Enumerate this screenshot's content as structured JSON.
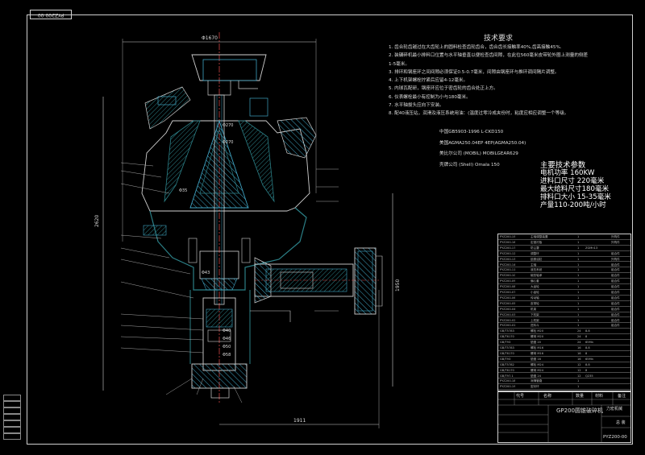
{
  "title_block": {
    "drawing_number": "PYZ200-00",
    "machine_name": "GP200圆锥破碎机",
    "company": "力宏机械",
    "ratio_label": "总 装",
    "code": "PYZ200-00",
    "header_cols": [
      "代号",
      "名称",
      "数量",
      "材料",
      "备注"
    ]
  },
  "technical_requirements": {
    "title": "技术要求",
    "items": [
      "1. 齿合轮齿越过在大齿轮上的圆料检查齿轮齿合，齿合齿长接触率40%,齿高接触45%.",
      "2. 装碾碎机最小排料口位置与水平轴垂直以便检查齿间隙，在此位560毫米皮带轮外圈上测量的侧差",
      "1-5毫米。",
      "3. 排环和钢座环之间间隙必须保证0.5-0.7毫米，间隙由钢座环与推环调间隔片调整。",
      "4. 上下机架螺栓拧紧后应留4-12毫米。",
      "5. 内球瓦配研，钢座环应位于密齿轮的齿合处正上方。",
      "6. 仪表螺栓最小有控制为小与180毫米。",
      "7. 水平轴拔头应向下安装。",
      "8. 配40液压站，润滑及液压系统用油：(温度过零冷成夹份时，粘度应相应调整一个等级。"
    ],
    "standards": [
      "中国GB5903-1996 L-CKD150",
      "美国AGMA250.04EP 4EP(AGMA250.04)",
      "美比尔公司 (MOBIL)      MOBILGEAR629",
      "壳牌公司 (Shell) Omala 150"
    ]
  },
  "main_parameters": {
    "title": "主要技术参数",
    "items": [
      "电机功率 160KW",
      "进料口尺寸 220毫米",
      "最大给料尺寸180毫米",
      "排料口大小 15-35毫米",
      "产量110-200吨/小时"
    ]
  },
  "dimensions": {
    "top_width": "Φ1670",
    "height_total": "2620",
    "right_height": "1950",
    "bottom_width": "1911",
    "d1": "Φ270",
    "d2": "Φ270",
    "d3": "Φ35",
    "d4": "Φ43",
    "d5": "Φ40",
    "d6": "Φ46",
    "d7": "Φ50",
    "d8": "Φ58"
  },
  "parts_list": [
    {
      "code": "PYZ200-15",
      "name": "主轴调整装置",
      "qty": "1",
      "mat": "",
      "note": "外购件"
    },
    {
      "code": "PYZ200-16",
      "name": "定锥衬板",
      "qty": "1",
      "mat": "",
      "note": "外购件"
    },
    {
      "code": "PYZ200-17",
      "name": "防尘罩",
      "qty": "1",
      "mat": "ZGMn13",
      "note": ""
    },
    {
      "code": "PYZ200-12",
      "name": "调整环",
      "qty": "1",
      "mat": "",
      "note": "组合件"
    },
    {
      "code": "PYZ200-13",
      "name": "锁紧油缸",
      "qty": "1",
      "mat": "",
      "note": "外购件"
    },
    {
      "code": "PYZ200-14",
      "name": "主轴",
      "qty": "1",
      "mat": "",
      "note": "组合件"
    },
    {
      "code": "PYZ200-11",
      "name": "液压系统",
      "qty": "1",
      "mat": "",
      "note": "组合件"
    },
    {
      "code": "PYZ200-10",
      "name": "碗形轴承",
      "qty": "1",
      "mat": "",
      "note": "组合件"
    },
    {
      "code": "PYZ200-09",
      "name": "偏心套",
      "qty": "1",
      "mat": "",
      "note": "组合件"
    },
    {
      "code": "PYZ200-08",
      "name": "大齿轮",
      "qty": "1",
      "mat": "",
      "note": "组合件"
    },
    {
      "code": "PYZ200-07",
      "name": "小齿轮",
      "qty": "1",
      "mat": "",
      "note": "组合件"
    },
    {
      "code": "PYZ200-06",
      "name": "传动轴",
      "qty": "1",
      "mat": "",
      "note": "组合件"
    },
    {
      "code": "PYZ200-05",
      "name": "皮带轮",
      "qty": "1",
      "mat": "",
      "note": "组合件"
    },
    {
      "code": "PYZ200-04",
      "name": "机架",
      "qty": "1",
      "mat": "",
      "note": "组合件"
    },
    {
      "code": "PYZ200-03",
      "name": "下机架",
      "qty": "1",
      "mat": "",
      "note": "组合件"
    },
    {
      "code": "PYZ200-02",
      "name": "上机架",
      "qty": "1",
      "mat": "",
      "note": "组合件"
    },
    {
      "code": "PYZ200-01",
      "name": "进料斗",
      "qty": "1",
      "mat": "",
      "note": "组合件"
    },
    {
      "code": "GB/T5783",
      "name": "螺栓 M20",
      "qty": "24",
      "mat": "8.8",
      "note": ""
    },
    {
      "code": "GB/T6170",
      "name": "螺母 M20",
      "qty": "24",
      "mat": "8",
      "note": ""
    },
    {
      "code": "GB/T93",
      "name": "垫圈 20",
      "qty": "24",
      "mat": "65Mn",
      "note": ""
    },
    {
      "code": "GB/T5783",
      "name": "螺栓 M16",
      "qty": "16",
      "mat": "8.8",
      "note": ""
    },
    {
      "code": "GB/T6170",
      "name": "螺母 M16",
      "qty": "16",
      "mat": "8",
      "note": ""
    },
    {
      "code": "GB/T93",
      "name": "垫圈 16",
      "qty": "16",
      "mat": "65Mn",
      "note": ""
    },
    {
      "code": "GB/T5782",
      "name": "螺栓 M24",
      "qty": "12",
      "mat": "8.8",
      "note": ""
    },
    {
      "code": "GB/T6170",
      "name": "螺母 M24",
      "qty": "12",
      "mat": "8",
      "note": ""
    },
    {
      "code": "GB/T97.1",
      "name": "垫圈 24",
      "qty": "12",
      "mat": "Q235",
      "note": ""
    },
    {
      "code": "PYZ200-18",
      "name": "润滑管路",
      "qty": "1",
      "mat": "",
      "note": ""
    },
    {
      "code": "PYZ200-19",
      "name": "密封环",
      "qty": "1",
      "mat": "",
      "note": ""
    }
  ],
  "colors": {
    "line": "#cfcfcf",
    "part_blue": "#3fa3c2",
    "part_teal": "#2b7f86",
    "text": "#dddddd"
  }
}
